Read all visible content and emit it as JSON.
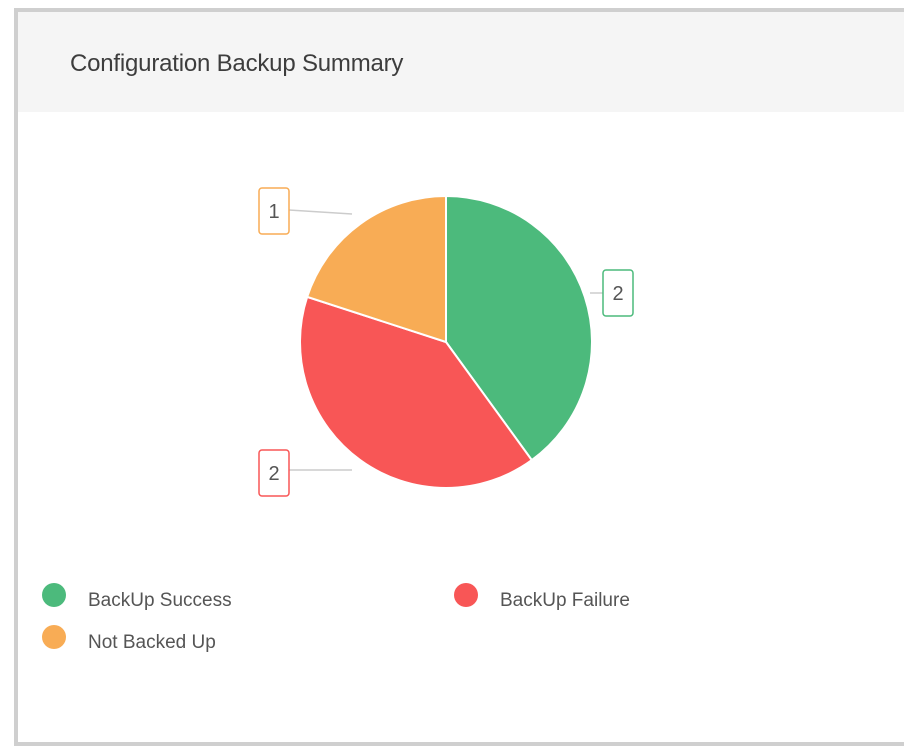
{
  "panel": {
    "title": "Configuration Backup Summary"
  },
  "chart_data": {
    "type": "pie",
    "title": "",
    "slices": [
      {
        "label": "BackUp Success",
        "value": 2,
        "color": "#4cba7c"
      },
      {
        "label": "BackUp Failure",
        "value": 2,
        "color": "#f85656"
      },
      {
        "label": "Not Backed Up",
        "value": 1,
        "color": "#f8ac55"
      }
    ],
    "data_labels": [
      "2",
      "2",
      "1"
    ],
    "legend_position": "bottom"
  },
  "legend": {
    "items": [
      {
        "label": "BackUp Success",
        "color": "#4cba7c"
      },
      {
        "label": "BackUp Failure",
        "color": "#f85656"
      },
      {
        "label": "Not Backed Up",
        "color": "#f8ac55"
      }
    ]
  }
}
